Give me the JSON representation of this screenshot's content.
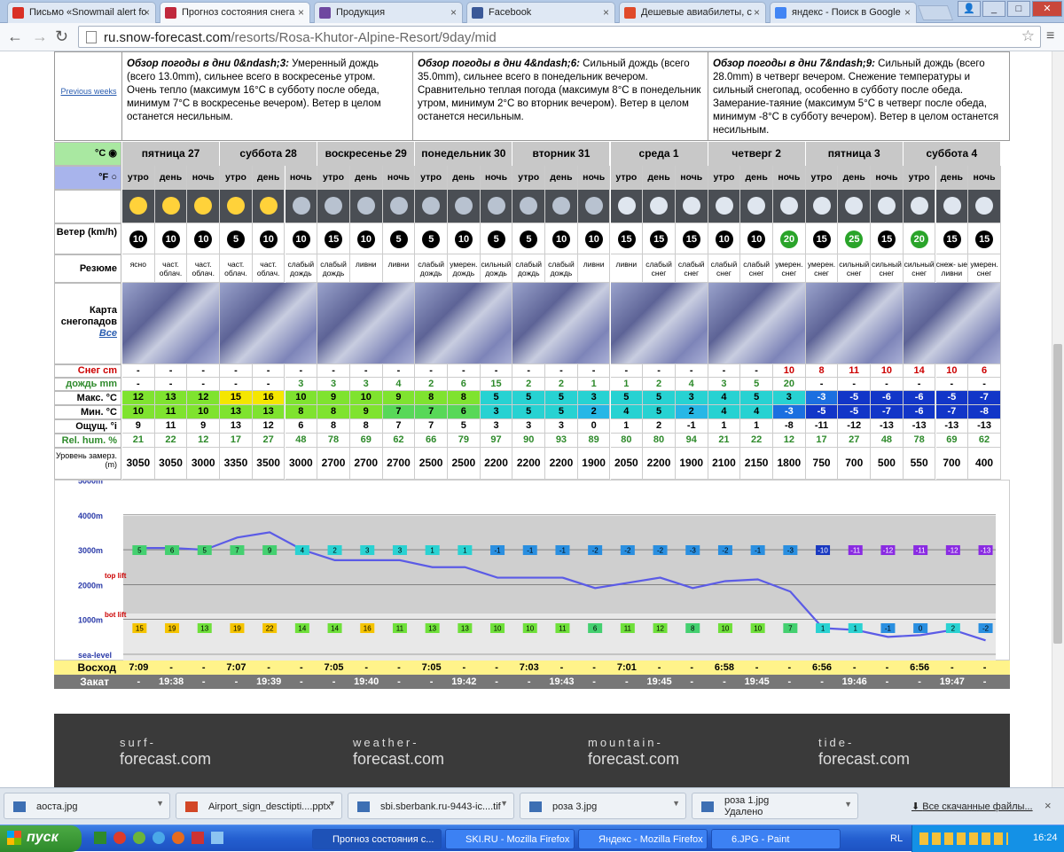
{
  "browser": {
    "tabs": [
      {
        "label": "Письмо «Snowmail alert fo",
        "color": "#d93025"
      },
      {
        "label": "Прогноз состояния снега",
        "color": "#c0283c"
      },
      {
        "label": "Продукция",
        "color": "#6e48a0"
      },
      {
        "label": "Facebook",
        "color": "#3b5998"
      },
      {
        "label": "Дешевые авиабилеты, с",
        "color": "#e04a2a"
      },
      {
        "label": "яндекс - Поиск в Google",
        "color": "#4285f4"
      }
    ],
    "url_host": "ru.snow-forecast.com",
    "url_path": "/resorts/Rosa-Khutor-Alpine-Resort/9day/mid",
    "window_buttons": [
      "_",
      "□",
      "✕"
    ]
  },
  "forecast": {
    "previous_weeks": "Previous weeks",
    "overviews": [
      {
        "title": "Обзор погоды в дни 0&ndash;3:",
        "text": "Умеренный дождь (всего 13.0mm), сильнее всего в воскресенье утром. Очень тепло (максимум 16°C в субботу после обеда, минимум 7°C в воскресенье вечером). Ветер в целом останется несильным."
      },
      {
        "title": "Обзор погоды в дни 4&ndash;6:",
        "text": "Сильный дождь (всего 35.0mm), сильнее всего в понедельник вечером. Сравнительно теплая погода (максимум 8°C в понедельник утром, минимум 2°C во вторник вечером). Ветер в целом останется несильным."
      },
      {
        "title": "Обзор погоды в дни 7&ndash;9:",
        "text": "Сильный дождь (всего 28.0mm) в четверг вечером. Снежение температуры и сильный снегопад, особенно в субботу после обеда. Замерание-таяние (максимум 5°C в четверг после обеда, минимум -8°C в субботу вечером). Ветер в целом останется несильным."
      }
    ],
    "unit_c": "°C",
    "unit_f": "°F",
    "days": [
      "пятница 27",
      "суббота 28",
      "воскресенье 29",
      "понедельник 30",
      "вторник 31",
      "среда 1",
      "четверг 2",
      "пятница 3",
      "суббота 4"
    ],
    "phases": [
      "утро",
      "день",
      "ночь"
    ],
    "labels": {
      "wind": "Ветер (km/h)",
      "summary": "Резюме",
      "snowmap": "Карта снегопадов",
      "snowmap_all": "Все",
      "snow": "Снег cm",
      "rain": "дождь mm",
      "max": "Макс. °C",
      "min": "Мин. °C",
      "feels": "Ощущ. °i",
      "hum": "Rel. hum. %",
      "freeze": "Уровень замерз. (m)",
      "sunrise": "Восход",
      "sunset": "Закат"
    },
    "wind": [
      10,
      10,
      10,
      5,
      10,
      10,
      15,
      10,
      5,
      5,
      10,
      5,
      5,
      10,
      10,
      15,
      15,
      15,
      10,
      10,
      20,
      15,
      25,
      15,
      20,
      15,
      15
    ],
    "wind_green": [
      20,
      22,
      24
    ],
    "summary": [
      "ясно",
      "част. облач.",
      "част. облач.",
      "част. облач.",
      "част. облач.",
      "слабый дождь",
      "слабый дождь",
      "ливни",
      "ливни",
      "слабый дождь",
      "умерен. дождь",
      "сильный дождь",
      "слабый дождь",
      "слабый дождь",
      "ливни",
      "ливни",
      "слабый снег",
      "слабый снег",
      "слабый снег",
      "слабый снег",
      "умерен. снег",
      "умерен. снег",
      "сильный снег",
      "сильный снег",
      "сильный снег",
      "снеж- ые ливни",
      "умерен. снег"
    ],
    "snow": [
      "-",
      "-",
      "-",
      "-",
      "-",
      "-",
      "-",
      "-",
      "-",
      "-",
      "-",
      "-",
      "-",
      "-",
      "-",
      "-",
      "-",
      "-",
      "-",
      "-",
      "10",
      "8",
      "11",
      "10",
      "14",
      "10",
      "6"
    ],
    "rain": [
      "-",
      "-",
      "-",
      "-",
      "-",
      "3",
      "3",
      "3",
      "4",
      "2",
      "6",
      "15",
      "2",
      "2",
      "1",
      "1",
      "2",
      "4",
      "3",
      "5",
      "20",
      "-",
      "-",
      "-",
      "-",
      "-",
      "-"
    ],
    "max": [
      12,
      13,
      12,
      15,
      16,
      10,
      9,
      10,
      9,
      8,
      8,
      5,
      5,
      5,
      3,
      5,
      5,
      3,
      4,
      5,
      3,
      -3,
      -5,
      -6,
      -6,
      -5,
      -7
    ],
    "min": [
      10,
      11,
      10,
      13,
      13,
      8,
      8,
      9,
      7,
      7,
      6,
      3,
      5,
      5,
      2,
      4,
      5,
      2,
      4,
      4,
      -3,
      -5,
      -5,
      -7,
      -6,
      -7,
      -8
    ],
    "feels": [
      9,
      11,
      9,
      13,
      12,
      6,
      8,
      8,
      7,
      7,
      5,
      3,
      3,
      3,
      0,
      1,
      2,
      -1,
      1,
      1,
      -8,
      -11,
      -12,
      -13,
      -13,
      -13,
      -13
    ],
    "hum": [
      21,
      22,
      12,
      17,
      27,
      48,
      78,
      69,
      62,
      66,
      79,
      97,
      90,
      93,
      89,
      80,
      80,
      94,
      21,
      22,
      12,
      17,
      27,
      48,
      78,
      69,
      62
    ],
    "freeze": [
      3050,
      3050,
      3000,
      3350,
      3500,
      3000,
      2700,
      2700,
      2700,
      2500,
      2500,
      2200,
      2200,
      2200,
      1900,
      2050,
      2200,
      1900,
      2100,
      2150,
      1800,
      750,
      700,
      500,
      550,
      700,
      400
    ],
    "chart_top_values": [
      5,
      6,
      5,
      7,
      9,
      4,
      2,
      3,
      3,
      1,
      1,
      -1,
      -1,
      -1,
      -2,
      -2,
      -2,
      -3,
      -2,
      -1,
      -3,
      -10,
      -11,
      -12,
      -11,
      -12,
      -13
    ],
    "chart_bot_values": [
      15,
      19,
      13,
      19,
      22,
      14,
      14,
      16,
      11,
      13,
      13,
      10,
      10,
      11,
      6,
      11,
      12,
      8,
      10,
      10,
      7,
      1,
      1,
      -1,
      0,
      2,
      -2
    ],
    "chart_axis": [
      "5000m",
      "4000m",
      "3000m",
      "2000m",
      "1000m",
      "sea-level"
    ],
    "chart_top_lift": "top lift",
    "chart_bot_lift": "bot lift",
    "sunrise": [
      "7:09",
      "-",
      "-",
      "7:07",
      "-",
      "-",
      "7:05",
      "-",
      "-",
      "7:05",
      "-",
      "-",
      "7:03",
      "-",
      "-",
      "7:01",
      "-",
      "-",
      "6:58",
      "-",
      "-",
      "6:56",
      "-",
      "-",
      "6:56",
      "-",
      "-"
    ],
    "sunset": [
      "-",
      "19:38",
      "-",
      "-",
      "19:39",
      "-",
      "-",
      "19:40",
      "-",
      "-",
      "19:42",
      "-",
      "-",
      "19:43",
      "-",
      "-",
      "19:45",
      "-",
      "-",
      "19:45",
      "-",
      "-",
      "19:46",
      "-",
      "-",
      "19:47",
      "-"
    ]
  },
  "footer": {
    "logos": [
      {
        "t1": "surf-",
        "t2": "forecast.com"
      },
      {
        "t1": "weather-",
        "t2": "forecast.com"
      },
      {
        "t1": "mountain-",
        "t2": "forecast.com"
      },
      {
        "t1": "tide-",
        "t2": "forecast.com"
      }
    ]
  },
  "downloads": {
    "items": [
      {
        "name": "аоста.jpg",
        "sub": ""
      },
      {
        "name": "Airport_sign_desctipti....pptx",
        "sub": ""
      },
      {
        "name": "sbi.sberbank.ru-9443-ic....tif",
        "sub": ""
      },
      {
        "name": "роза 3.jpg",
        "sub": ""
      },
      {
        "name": "роза 1.jpg",
        "sub": "Удалено"
      }
    ],
    "all": "Все скачанные файлы..."
  },
  "taskbar": {
    "start": "пуск",
    "tasks": [
      "Прогноз состояния с...",
      "SKI.RU - Mozilla Firefox",
      "Яндекс - Mozilla Firefox",
      "6.JPG - Paint"
    ],
    "lang": "RL",
    "time": "16:24"
  }
}
